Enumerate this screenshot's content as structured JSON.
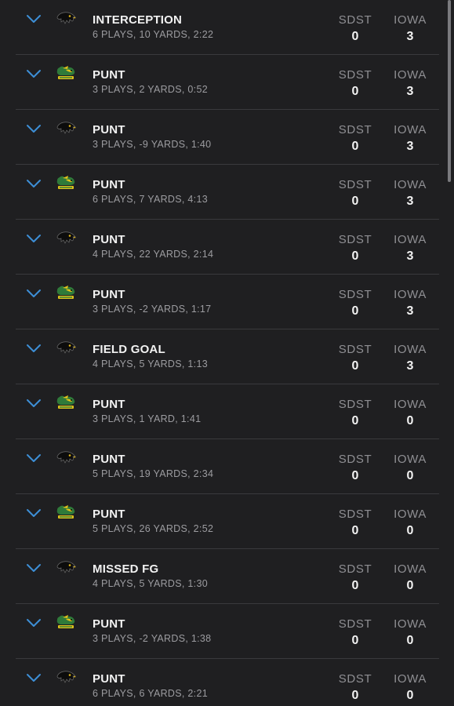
{
  "colors": {
    "background": "#1f1f21",
    "chevron": "#3d8fd6",
    "primary_text": "#f2f2f2",
    "secondary_text": "#9c9ca0",
    "divider": "#3a3a3d"
  },
  "drives": [
    {
      "team_logo": "iowa-hawkeye-logo",
      "result": "INTERCEPTION",
      "summary": "6 PLAYS, 10 YARDS, 2:22",
      "away_abbr": "SDST",
      "away_score": "0",
      "home_abbr": "IOWA",
      "home_score": "3"
    },
    {
      "team_logo": "sdst-jackrabbits-logo",
      "result": "PUNT",
      "summary": "3 PLAYS, 2 YARDS, 0:52",
      "away_abbr": "SDST",
      "away_score": "0",
      "home_abbr": "IOWA",
      "home_score": "3"
    },
    {
      "team_logo": "iowa-hawkeye-logo",
      "result": "PUNT",
      "summary": "3 PLAYS, -9 YARDS, 1:40",
      "away_abbr": "SDST",
      "away_score": "0",
      "home_abbr": "IOWA",
      "home_score": "3"
    },
    {
      "team_logo": "sdst-jackrabbits-logo",
      "result": "PUNT",
      "summary": "6 PLAYS, 7 YARDS, 4:13",
      "away_abbr": "SDST",
      "away_score": "0",
      "home_abbr": "IOWA",
      "home_score": "3"
    },
    {
      "team_logo": "iowa-hawkeye-logo",
      "result": "PUNT",
      "summary": "4 PLAYS, 22 YARDS, 2:14",
      "away_abbr": "SDST",
      "away_score": "0",
      "home_abbr": "IOWA",
      "home_score": "3"
    },
    {
      "team_logo": "sdst-jackrabbits-logo",
      "result": "PUNT",
      "summary": "3 PLAYS, -2 YARDS, 1:17",
      "away_abbr": "SDST",
      "away_score": "0",
      "home_abbr": "IOWA",
      "home_score": "3"
    },
    {
      "team_logo": "iowa-hawkeye-logo",
      "result": "FIELD GOAL",
      "summary": "4 PLAYS, 5 YARDS, 1:13",
      "away_abbr": "SDST",
      "away_score": "0",
      "home_abbr": "IOWA",
      "home_score": "3"
    },
    {
      "team_logo": "sdst-jackrabbits-logo",
      "result": "PUNT",
      "summary": "3 PLAYS, 1 YARD, 1:41",
      "away_abbr": "SDST",
      "away_score": "0",
      "home_abbr": "IOWA",
      "home_score": "0"
    },
    {
      "team_logo": "iowa-hawkeye-logo",
      "result": "PUNT",
      "summary": "5 PLAYS, 19 YARDS, 2:34",
      "away_abbr": "SDST",
      "away_score": "0",
      "home_abbr": "IOWA",
      "home_score": "0"
    },
    {
      "team_logo": "sdst-jackrabbits-logo",
      "result": "PUNT",
      "summary": "5 PLAYS, 26 YARDS, 2:52",
      "away_abbr": "SDST",
      "away_score": "0",
      "home_abbr": "IOWA",
      "home_score": "0"
    },
    {
      "team_logo": "iowa-hawkeye-logo",
      "result": "MISSED FG",
      "summary": "4 PLAYS, 5 YARDS, 1:30",
      "away_abbr": "SDST",
      "away_score": "0",
      "home_abbr": "IOWA",
      "home_score": "0"
    },
    {
      "team_logo": "sdst-jackrabbits-logo",
      "result": "PUNT",
      "summary": "3 PLAYS, -2 YARDS, 1:38",
      "away_abbr": "SDST",
      "away_score": "0",
      "home_abbr": "IOWA",
      "home_score": "0"
    },
    {
      "team_logo": "iowa-hawkeye-logo",
      "result": "PUNT",
      "summary": "6 PLAYS, 6 YARDS, 2:21",
      "away_abbr": "SDST",
      "away_score": "0",
      "home_abbr": "IOWA",
      "home_score": "0"
    }
  ]
}
